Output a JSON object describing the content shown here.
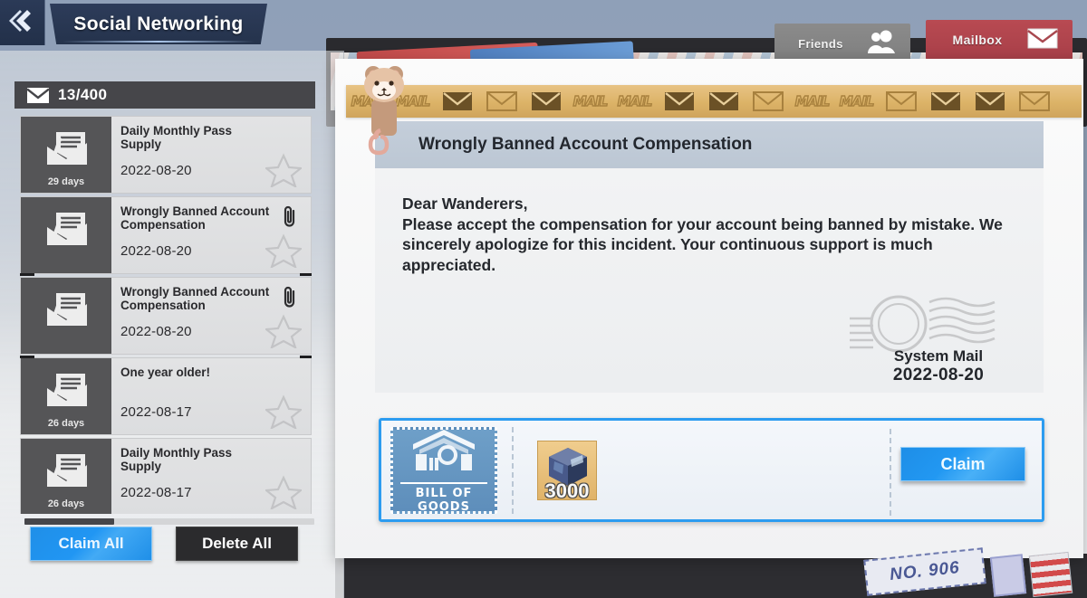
{
  "header": {
    "back_icon": "chevron-left-icon",
    "title": "Social Networking"
  },
  "tabs": [
    {
      "label": "Friends",
      "icon": "friends-icon",
      "active": false
    },
    {
      "label": "Mailbox",
      "icon": "envelope-icon",
      "active": true
    }
  ],
  "sidebar": {
    "count_icon": "envelope-icon",
    "count_text": "13/400",
    "items": [
      {
        "subject": "Daily Monthly Pass Supply",
        "date": "2022-08-20",
        "days": "29 days",
        "has_attachment": false,
        "selected": false
      },
      {
        "subject": "Wrongly Banned Account Compensation",
        "date": "2022-08-20",
        "days": "",
        "has_attachment": true,
        "selected": false
      },
      {
        "subject": "Wrongly Banned Account Compensation",
        "date": "2022-08-20",
        "days": "",
        "has_attachment": true,
        "selected": true
      },
      {
        "subject": "One year older!",
        "date": "2022-08-17",
        "days": "26 days",
        "has_attachment": false,
        "selected": false
      },
      {
        "subject": "Daily Monthly Pass Supply",
        "date": "2022-08-17",
        "days": "26 days",
        "has_attachment": false,
        "selected": false
      }
    ],
    "claim_all_label": "Claim All",
    "delete_all_label": "Delete All"
  },
  "mail": {
    "tape_word": "MAIL",
    "tape_pattern": [
      "word",
      "word",
      "env",
      "env",
      "env",
      "word",
      "word",
      "env",
      "env",
      "env",
      "word",
      "word",
      "env",
      "env",
      "env",
      "env"
    ],
    "title": "Wrongly Banned Account Compensation",
    "greeting": "Dear Wanderers,",
    "body": "Please accept the compensation for your account being banned by mistake. We sincerely apologize for this incident. Your continuous support is much appreciated.",
    "sender": "System Mail",
    "date": "2022-08-20"
  },
  "attachment": {
    "ticket_label": "BILL OF GOODS",
    "ticket_icon": "warehouse-box-icon",
    "item_icon": "crystal-cube-icon",
    "item_count": "3000",
    "claim_label": "Claim"
  },
  "decor": {
    "stamp_number": "NO. 906",
    "mascot": "bear-paperclip-icon"
  },
  "colors": {
    "accent_blue": "#2196f3",
    "mailbox_red": "#b84a52",
    "tape_gold": "#dcb367",
    "panel_header": "#c4ceda",
    "dark": "#2b2b2d"
  }
}
